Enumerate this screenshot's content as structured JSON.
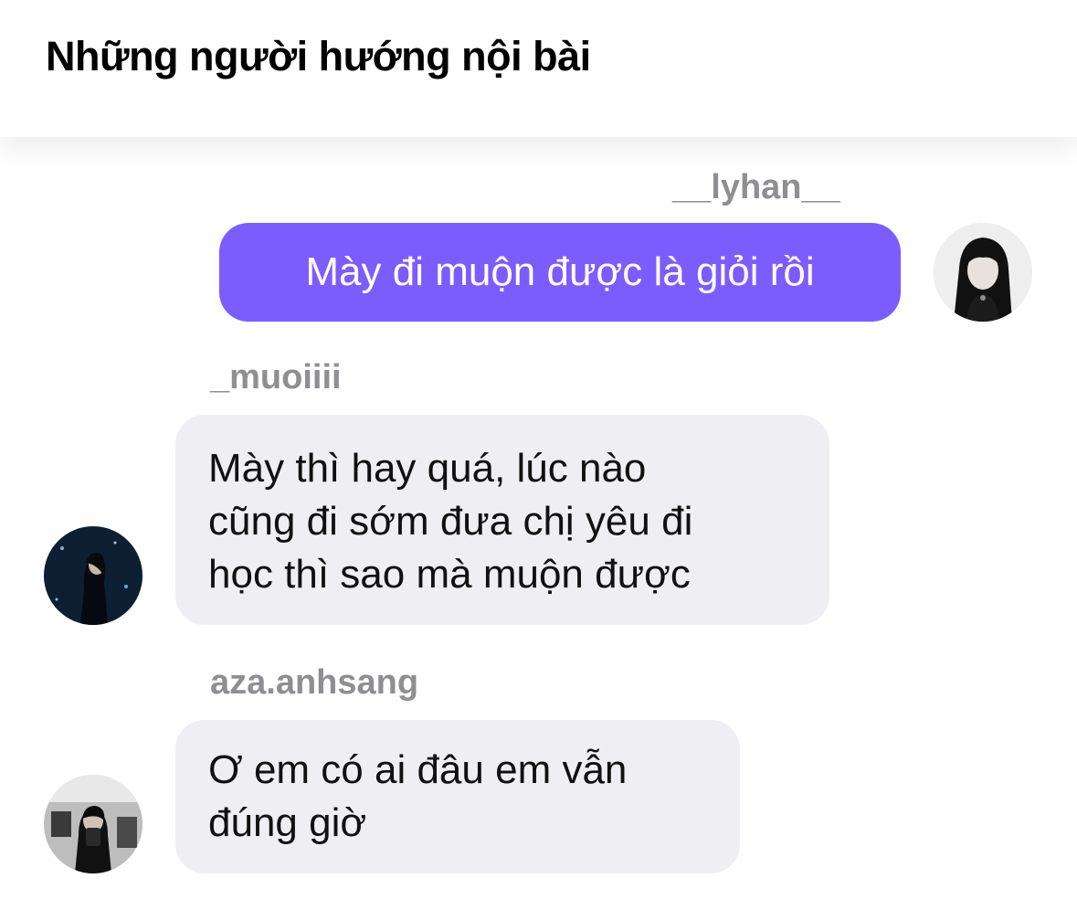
{
  "header": {
    "title": "Những người hướng nội bài"
  },
  "messages": [
    {
      "sender": "__lyhan__",
      "text": "Mày đi muộn được là giỏi rồi",
      "avatar_icon": "user-avatar-icon",
      "is_own": true
    },
    {
      "sender": "_muoiiii",
      "text_lines": [
        "Mày thì hay quá, lúc nào",
        "cũng đi sớm đưa chị yêu đi",
        "học thì sao mà muộn được"
      ],
      "avatar_icon": "user-avatar-icon",
      "is_own": false
    },
    {
      "sender": "aza.anhsang",
      "text_lines": [
        "Ơ em có ai đâu em vẫn",
        "đúng giờ"
      ],
      "avatar_icon": "user-avatar-icon",
      "is_own": false
    }
  ],
  "colors": {
    "own_bubble": "#7b5cff",
    "other_bubble": "#efeff3",
    "sender_name": "#8e8e93"
  }
}
